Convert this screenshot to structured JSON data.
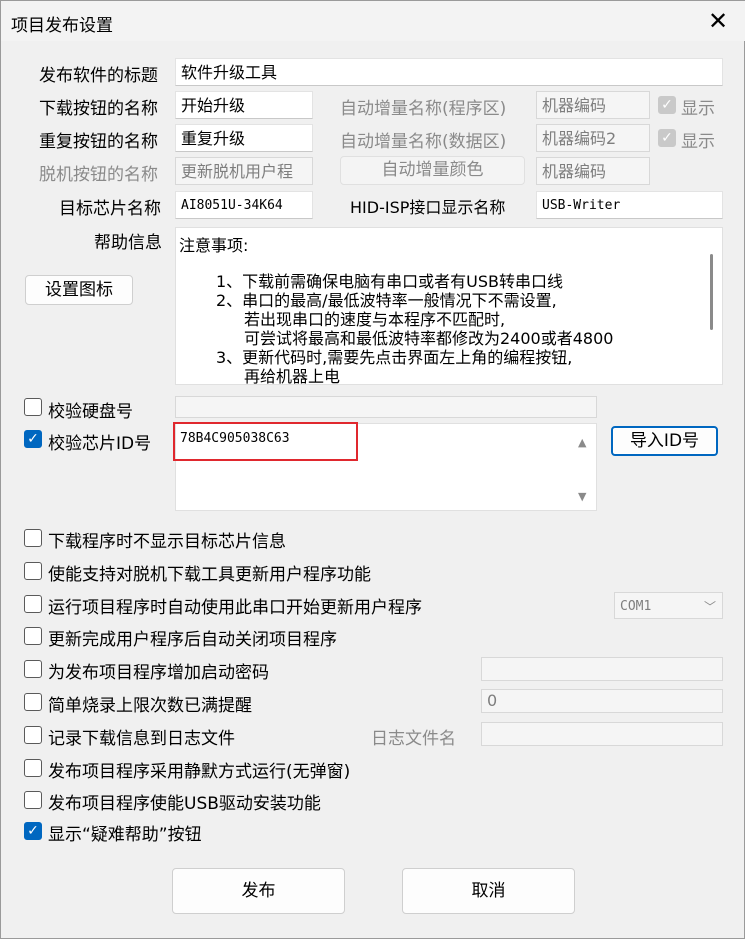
{
  "window": {
    "title": "项目发布设置"
  },
  "icons": {
    "close": "close-icon",
    "combo": "chevron-down-icon"
  },
  "colors": {
    "accent": "#0067c0",
    "highlight": "#e0282e"
  },
  "rows": {
    "title_label": "发布软件的标题",
    "title_value": "软件升级工具",
    "download_label": "下载按钮的名称",
    "download_value": "开始升级",
    "repeat_label": "重复按钮的名称",
    "repeat_value": "重复升级",
    "offline_label": "脱机按钮的名称",
    "offline_value": "更新脱机用户程",
    "chip_label": "目标芯片名称",
    "chip_value": "AI8051U-34K64",
    "hid_label": "HID-ISP接口显示名称",
    "hid_value": "USB-Writer"
  },
  "auto_inc": {
    "program_label": "自动增量名称(程序区)",
    "program_value": "机器编码",
    "program_show": "显示",
    "data_label": "自动增量名称(数据区)",
    "data_value": "机器编码2",
    "data_show": "显示",
    "color_button": "自动增量颜色",
    "color_value": "机器编码"
  },
  "help": {
    "label": "帮助信息",
    "lines": [
      "注意事项:",
      "1、下载前需确保电脑有串口或者有USB转串口线",
      "2、串口的最高/最低波特率一般情况下不需设置,",
      "若出现串口的速度与本程序不匹配时,",
      "可尝试将最高和最低波特率都修改为2400或者4800",
      "3、更新代码时,需要先点击界面左上角的编程按钮,",
      "再给机器上电"
    ]
  },
  "icon_button": "设置图标",
  "verify": {
    "disk_label": "校验硬盘号",
    "disk_checked": false,
    "chip_label": "校验芯片ID号",
    "chip_checked": true,
    "chip_id": "78B4C905038C63",
    "import_button": "导入ID号"
  },
  "options": [
    {
      "label": "下载程序时不显示目标芯片信息",
      "checked": false
    },
    {
      "label": "使能支持对脱机下载工具更新用户程序功能",
      "checked": false
    },
    {
      "label": "运行项目程序时自动使用此串口开始更新用户程序",
      "checked": false
    },
    {
      "label": "更新完成用户程序后自动关闭项目程序",
      "checked": false
    },
    {
      "label": "为发布项目程序增加启动密码",
      "checked": false
    },
    {
      "label": "简单烧录上限次数已满提醒",
      "checked": false
    },
    {
      "label": "记录下载信息到日志文件",
      "checked": false
    },
    {
      "label": "发布项目程序采用静默方式运行(无弹窗)",
      "checked": false
    },
    {
      "label": "发布项目程序使能USB驱动安装功能",
      "checked": false
    },
    {
      "label": "显示“疑难帮助”按钮",
      "checked": true
    }
  ],
  "com_port": "COM1",
  "limit_value": "0",
  "log_label": "日志文件名",
  "buttons": {
    "publish": "发布",
    "cancel": "取消"
  }
}
